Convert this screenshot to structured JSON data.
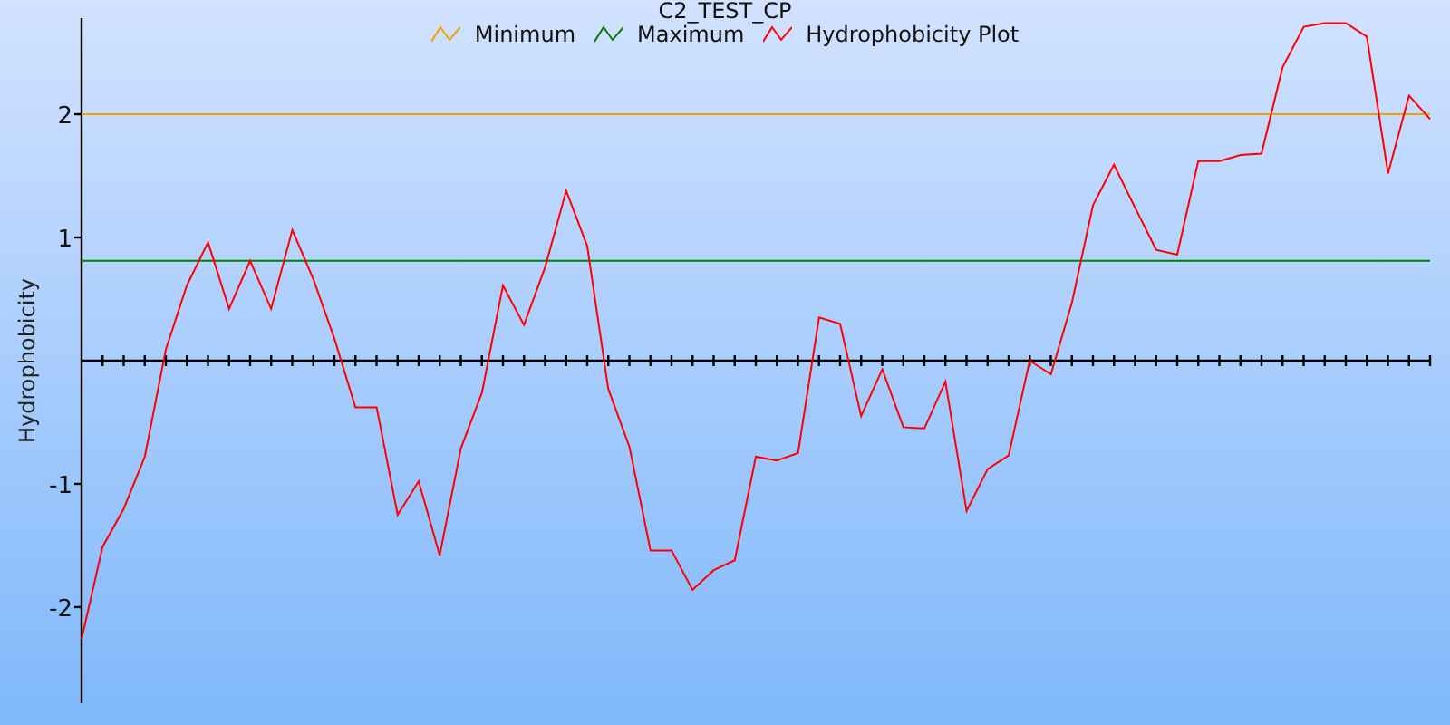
{
  "chart_data": {
    "type": "line",
    "title": "C2_TEST_CP",
    "ylabel": "Hydrophobicity",
    "ylim": [
      -2.78,
      2.78
    ],
    "yticks": [
      -2,
      -1,
      1,
      2
    ],
    "series": [
      {
        "name": "Minimum",
        "color": "#f0a000",
        "values": [
          2,
          2,
          2,
          2,
          2,
          2,
          2,
          2,
          2,
          2,
          2,
          2,
          2,
          2,
          2,
          2,
          2,
          2,
          2,
          2,
          2,
          2,
          2,
          2,
          2,
          2,
          2,
          2,
          2,
          2,
          2,
          2,
          2,
          2,
          2,
          2,
          2,
          2,
          2,
          2,
          2,
          2,
          2,
          2,
          2,
          2,
          2,
          2,
          2,
          2,
          2,
          2,
          2,
          2,
          2,
          2,
          2,
          2,
          2,
          2,
          2,
          2,
          2,
          2,
          2
        ]
      },
      {
        "name": "Maximum",
        "color": "#008000",
        "values": [
          0.81,
          0.81,
          0.81,
          0.81,
          0.81,
          0.81,
          0.81,
          0.81,
          0.81,
          0.81,
          0.81,
          0.81,
          0.81,
          0.81,
          0.81,
          0.81,
          0.81,
          0.81,
          0.81,
          0.81,
          0.81,
          0.81,
          0.81,
          0.81,
          0.81,
          0.81,
          0.81,
          0.81,
          0.81,
          0.81,
          0.81,
          0.81,
          0.81,
          0.81,
          0.81,
          0.81,
          0.81,
          0.81,
          0.81,
          0.81,
          0.81,
          0.81,
          0.81,
          0.81,
          0.81,
          0.81,
          0.81,
          0.81,
          0.81,
          0.81,
          0.81,
          0.81,
          0.81,
          0.81,
          0.81,
          0.81,
          0.81,
          0.81,
          0.81,
          0.81,
          0.81,
          0.81,
          0.81,
          0.81,
          0.81
        ]
      },
      {
        "name": "Hydrophobicity Plot",
        "color": "#ff0000",
        "values": [
          -2.26,
          -1.51,
          -1.2,
          -0.78,
          0.09,
          0.61,
          0.96,
          0.42,
          0.81,
          0.42,
          1.06,
          0.66,
          0.18,
          -0.38,
          -0.38,
          -1.25,
          -0.98,
          -1.58,
          -0.71,
          -0.26,
          0.61,
          0.29,
          0.76,
          1.38,
          0.93,
          -0.23,
          -0.7,
          -1.54,
          -1.54,
          -1.86,
          -1.7,
          -1.62,
          -0.78,
          -0.81,
          -0.75,
          0.35,
          0.3,
          -0.45,
          -0.07,
          -0.54,
          -0.55,
          -0.17,
          -1.22,
          -0.88,
          -0.77,
          0,
          -0.11,
          0.47,
          1.26,
          1.59,
          1.24,
          0.9,
          0.86,
          1.62,
          1.62,
          1.67,
          1.68,
          2.38,
          2.71,
          2.74,
          2.74,
          2.63,
          1.52,
          2.15,
          1.96
        ]
      }
    ]
  }
}
